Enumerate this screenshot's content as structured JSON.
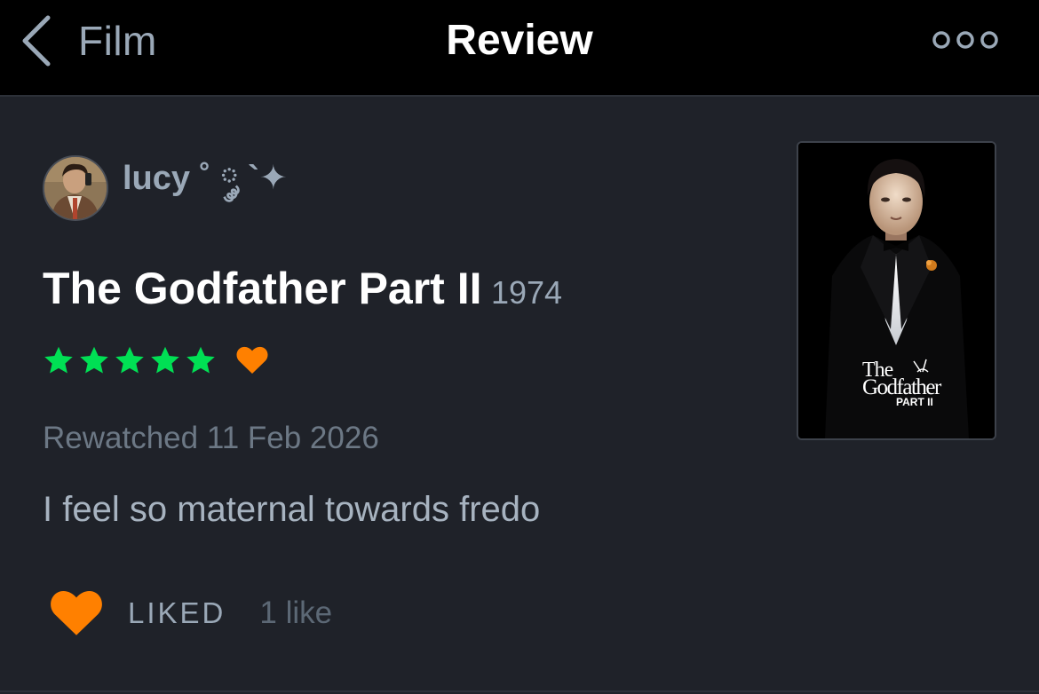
{
  "nav": {
    "back_label": "Film",
    "title": "Review",
    "more_icon": "ellipsis-icon"
  },
  "review": {
    "author": "lucy ˚ ༘ `✦",
    "film_title": "The Godfather Part II",
    "film_year": "1974",
    "rating_stars": 5,
    "rating_max": 5,
    "liked": true,
    "watch_status": "Rewatched 11 Feb 2026",
    "text": "I feel so maternal towards fredo",
    "like_label": "LIKED",
    "like_count": "1 like"
  },
  "poster": {
    "line1": "The",
    "line2": "Godfather",
    "line3": "PART II"
  },
  "colors": {
    "background": "#1f2229",
    "navbar": "#000000",
    "star": "#00e054",
    "heart": "#ff8000",
    "muted_text": "#9aa8b7",
    "title_text": "#ffffff"
  }
}
